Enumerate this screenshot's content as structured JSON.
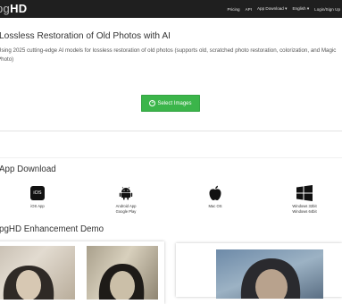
{
  "header": {
    "brand_left": "pg",
    "brand_right": "HD",
    "nav": {
      "pricing": "Pricing",
      "api": "API",
      "app_download": "App Download",
      "english": "English",
      "login": "Login/Sign Up"
    }
  },
  "hero": {
    "title": "Lossless Restoration of Old Photos with AI",
    "description": "Using 2025 cutting-edge AI models for lossless restoration of old photos (supports old, scratched photo restoration, colorization, and Magic Photo)",
    "select_button": "Select Images"
  },
  "app_download": {
    "title": "App Download",
    "items": [
      {
        "icon": "ios-icon",
        "badge": "iOS",
        "label": "iOS App"
      },
      {
        "icon": "android-icon",
        "label": "Android App",
        "sublabel": "Google Play"
      },
      {
        "icon": "apple-icon",
        "label": "Mac OS"
      },
      {
        "icon": "windows-icon",
        "label": "Windows 32bit",
        "sublabel": "Windows 64bit"
      }
    ]
  },
  "demo": {
    "title": "pgHD Enhancement Demo"
  },
  "colors": {
    "topbar": "#1f1f1f",
    "accent_green": "#3bb54a"
  }
}
